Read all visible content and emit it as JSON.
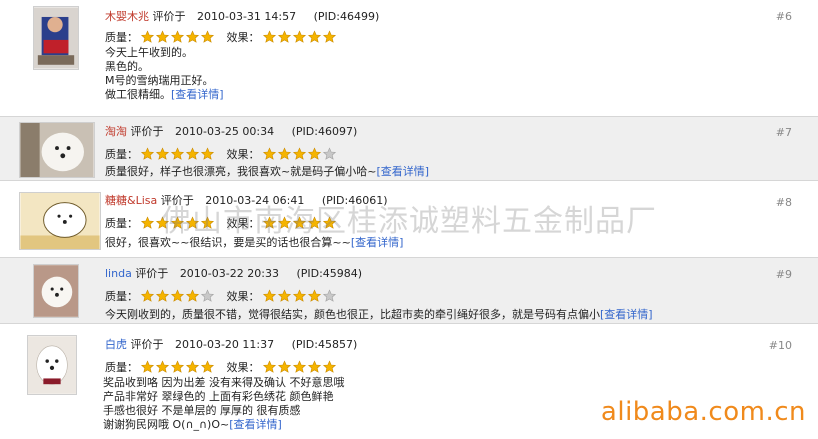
{
  "reviews": [
    {
      "user": "木婴木兆",
      "posted_label": "评价于",
      "date": "2010-03-31 14:57",
      "pid": "(PID:46499)",
      "num": "#6",
      "quality_label": "质量：",
      "quality_stars": 5,
      "effect_label": "效果：",
      "effect_stars": 5,
      "text_lines": [
        "今天上午收到的。",
        "黑色的。",
        "M号的雪纳瑞用正好。",
        "做工很精细。"
      ],
      "detail_link": "[查看详情]"
    },
    {
      "user": "淘淘",
      "posted_label": "评价于",
      "date": "2010-03-25 00:34",
      "pid": "(PID:46097)",
      "num": "#7",
      "quality_label": "质量：",
      "quality_stars": 5,
      "effect_label": "效果：",
      "effect_stars": 4,
      "text_lines": [
        "质量很好，样子也很漂亮，我很喜欢~就是码子偏小哈~"
      ],
      "detail_link": "[查看详情]"
    },
    {
      "user": "糖糖&Lisa",
      "posted_label": "评价于",
      "date": "2010-03-24 06:41",
      "pid": "(PID:46061)",
      "num": "#8",
      "quality_label": "质量：",
      "quality_stars": 5,
      "effect_label": "效果：",
      "effect_stars": 5,
      "text_lines": [
        "很好，很喜欢~~很结识，要是买的话也很合算~~"
      ],
      "detail_link": "[查看详情]"
    },
    {
      "user": "linda",
      "posted_label": "评价于",
      "date": "2010-03-22 20:33",
      "pid": "(PID:45984)",
      "num": "#9",
      "quality_label": "质量：",
      "quality_stars": 4,
      "effect_label": "效果：",
      "effect_stars": 4,
      "text_lines": [
        "今天刚收到的，质量很不错，觉得很结实，颜色也很正，比超市卖的牵引绳好很多，就是号码有点偏小"
      ],
      "detail_link": "[查看详情]"
    },
    {
      "user": "白虎",
      "posted_label": "评价于",
      "date": "2010-03-20 11:37",
      "pid": "(PID:45857)",
      "num": "#10",
      "quality_label": "质量：",
      "quality_stars": 5,
      "effect_label": "效果：",
      "effect_stars": 5,
      "text_lines": [
        "奖品收到咯 因为出差 没有来得及确认 不好意思哦",
        "产品非常好 翠绿色的 上面有彩色绣花 颜色鲜艳",
        "手感也很好 不是单层的 厚厚的 很有质感",
        "谢谢狗民网哦 O(∩_∩)O~"
      ],
      "detail_link": "[查看详情]"
    }
  ],
  "watermark": "佛山市南海区桂添诚塑料五金制品厂",
  "brand": "alibaba.com.cn",
  "colors": {
    "star_on": "#f5b400",
    "star_off": "#c8c8c8",
    "link": "#3366cc",
    "user": "#c0392b",
    "brand": "#f08a1c"
  }
}
